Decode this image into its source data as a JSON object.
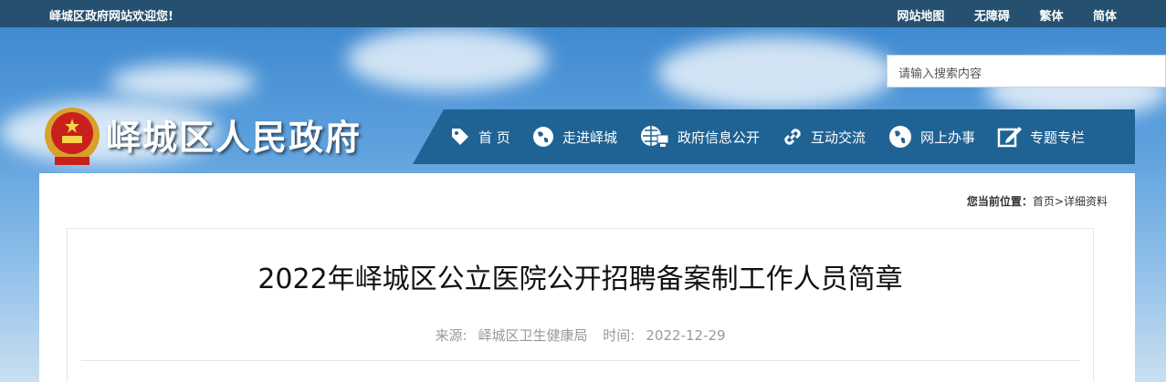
{
  "topbar": {
    "welcome": "峄城区政府网站欢迎您!",
    "links": [
      "网站地图",
      "无障碍",
      "繁体",
      "简体"
    ]
  },
  "search": {
    "placeholder": "请输入搜索内容"
  },
  "site": {
    "title": "峄城区人民政府"
  },
  "nav": {
    "items": [
      {
        "label": "首 页",
        "icon": "tag-icon"
      },
      {
        "label": "走进峄城",
        "icon": "globe-icon"
      },
      {
        "label": "政府信息公开",
        "icon": "computer-globe-icon"
      },
      {
        "label": "互动交流",
        "icon": "link-icon"
      },
      {
        "label": "网上办事",
        "icon": "globe-icon"
      },
      {
        "label": "专题专栏",
        "icon": "edit-icon"
      }
    ]
  },
  "breadcrumb": {
    "prefix": "您当前位置：",
    "home": "首页",
    "sep": ">",
    "current": "详细资料"
  },
  "article": {
    "title": "2022年峄城区公立医院公开招聘备案制工作人员简章",
    "source_label": "来源:",
    "source": "峄城区卫生健康局",
    "time_label": "时间:",
    "time": "2022-12-29"
  },
  "colors": {
    "topbar": "#26506f",
    "nav": "#1f6394"
  }
}
